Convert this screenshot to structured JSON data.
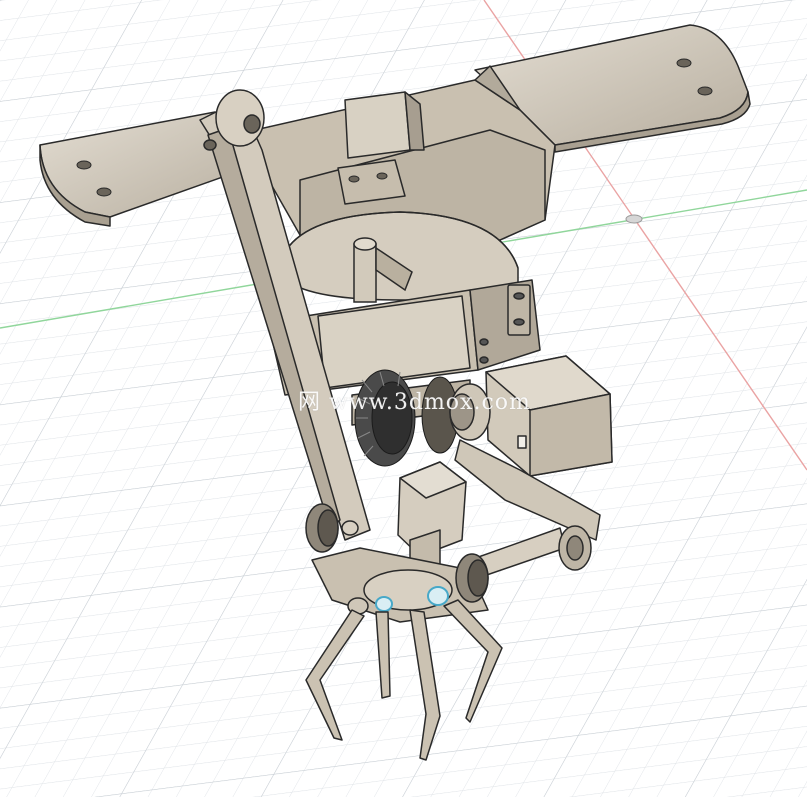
{
  "app": {
    "view_type": "3D CAD viewport",
    "background_color": "#ffffff",
    "grid_color": "#d9dde2",
    "axis_x_color": "#e8a0a0",
    "axis_y_color": "#8fd69a",
    "part_color": "#cfc6b6",
    "part_shade": "#9e968a",
    "edge_color": "#222222",
    "highlight_color": "#47a8c8"
  },
  "watermark": {
    "text": "网 www.3dmox.com"
  },
  "model": {
    "components": [
      "mounting-plate",
      "swing-arm",
      "turntable-disc",
      "servo-motor",
      "bevel-gear",
      "gripper-servo",
      "claw-finger",
      "knurled-knob"
    ]
  }
}
